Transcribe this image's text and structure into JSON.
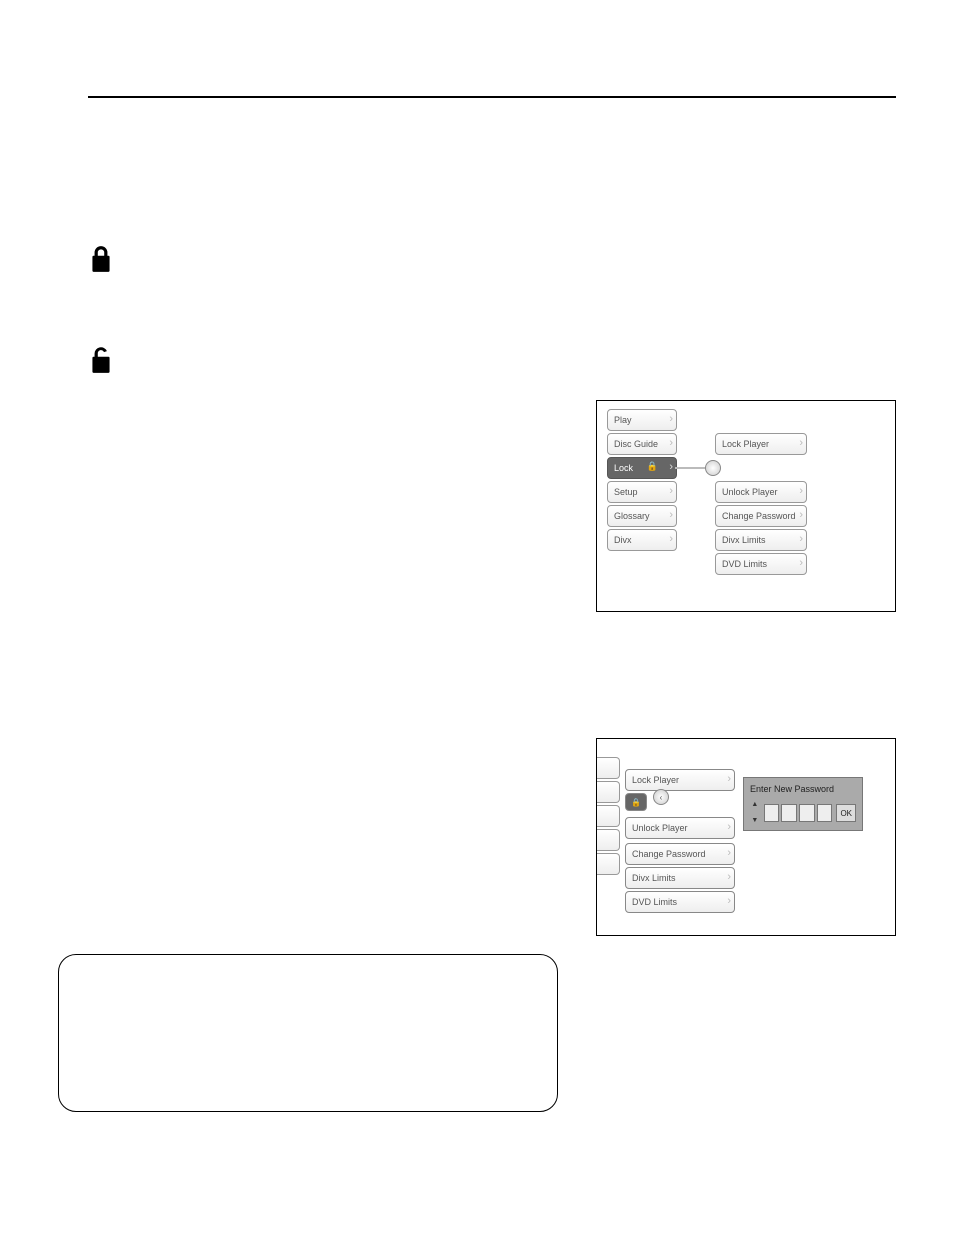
{
  "icons": {
    "locked": "locked-padlock",
    "unlocked": "unlocked-padlock"
  },
  "figure1": {
    "left_menu": [
      "Play",
      "Disc Guide",
      "Lock",
      "Setup",
      "Glossary",
      "Divx"
    ],
    "left_selected_index": 2,
    "right_menu": [
      "Lock Player",
      "Unlock Player",
      "Change Password",
      "Divx Limits",
      "DVD Limits"
    ]
  },
  "figure2": {
    "right_menu": [
      "Lock Player",
      "Unlock Player",
      "Change Password",
      "Divx Limits",
      "DVD Limits"
    ],
    "popup_title": "Enter New Password",
    "popup_ok": "OK"
  }
}
